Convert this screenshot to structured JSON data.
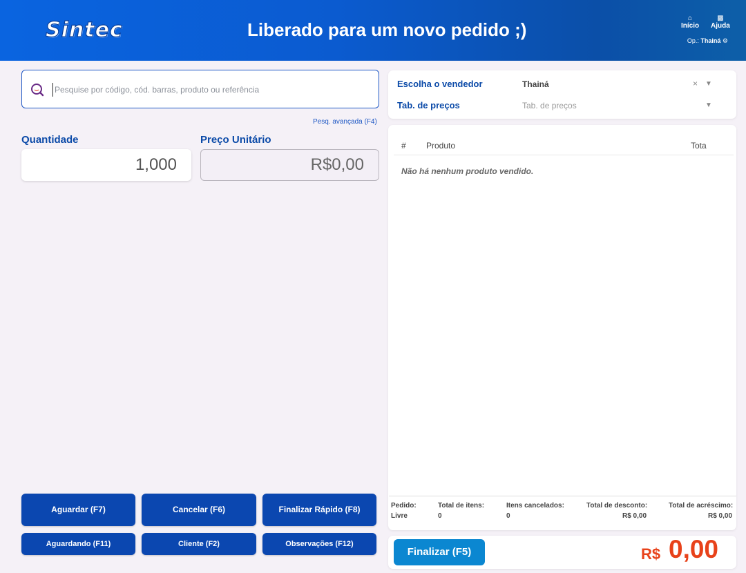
{
  "header": {
    "logo": "Sintec",
    "title": "Liberado para um novo pedido ;)",
    "nav": [
      {
        "label": "Início",
        "icon": "home-icon"
      },
      {
        "label": "Ajuda",
        "icon": "help-icon"
      }
    ],
    "operator_prefix": "Op.:",
    "operator_name": "Thainá"
  },
  "search": {
    "placeholder": "Pesquise por código, cód. barras, produto ou referência",
    "advanced_link": "Pesq. avançada (F4)"
  },
  "quantity": {
    "label": "Quantidade",
    "value": "1,000"
  },
  "unit_price": {
    "label": "Preço Unitário",
    "value": "R$0,00"
  },
  "actions": {
    "wait": "Aguardar (F7)",
    "cancel": "Cancelar (F6)",
    "quick_finish": "Finalizar Rápido (F8)",
    "waiting": "Aguardando (F11)",
    "client": "Cliente (F2)",
    "notes": "Observações (F12)"
  },
  "seller": {
    "label": "Escolha o vendedor",
    "value": "Thainá",
    "price_table_label": "Tab. de preços",
    "price_table_placeholder": "Tab. de preços"
  },
  "table": {
    "columns": [
      "#",
      "Produto",
      "Tota"
    ],
    "empty_message": "Não há nenhum produto vendido."
  },
  "summary": [
    {
      "label": "Pedido:",
      "value": "Livre"
    },
    {
      "label": "Total de itens:",
      "value": "0"
    },
    {
      "label": "Itens cancelados:",
      "value": "0"
    },
    {
      "label": "Total de desconto:",
      "value": "R$ 0,00"
    },
    {
      "label": "Total de acréscimo:",
      "value": "R$ 0,00"
    }
  ],
  "finalize": {
    "button": "Finalizar (F5)",
    "currency": "R$",
    "total": "0,00"
  },
  "colors": {
    "primary": "#0b47b0",
    "accent_total": "#e8421a",
    "finalize_button": "#0b87d1"
  }
}
